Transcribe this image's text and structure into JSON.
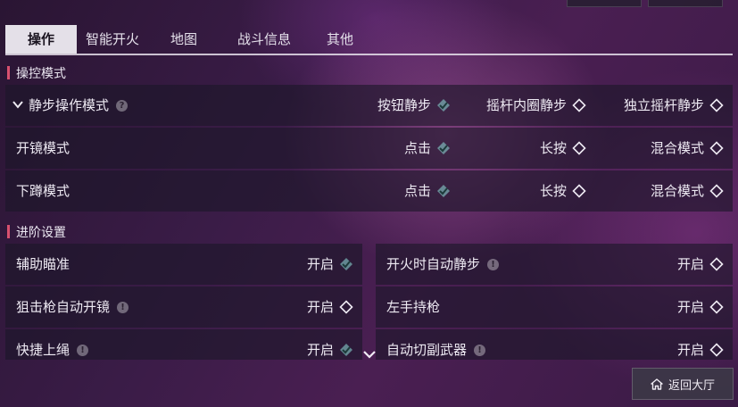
{
  "tabs": [
    {
      "label": "操作"
    },
    {
      "label": "智能开火"
    },
    {
      "label": "地图"
    },
    {
      "label": "战斗信息"
    },
    {
      "label": "其他"
    }
  ],
  "section_control": {
    "title": "操控模式",
    "rows": [
      {
        "label": "静步操作模式",
        "options": [
          "按钮静步",
          "摇杆内圈静步",
          "独立摇杆静步"
        ],
        "selected": 0
      },
      {
        "label": "开镜模式",
        "options": [
          "点击",
          "长按",
          "混合模式"
        ],
        "selected": 0
      },
      {
        "label": "下蹲模式",
        "options": [
          "点击",
          "长按",
          "混合模式"
        ],
        "selected": 0
      }
    ]
  },
  "section_advanced": {
    "title": "进阶设置",
    "items": [
      {
        "label": "辅助瞄准",
        "value": "开启",
        "checked": true,
        "info": false
      },
      {
        "label": "开火时自动静步",
        "value": "开启",
        "checked": false,
        "info": true
      },
      {
        "label": "狙击枪自动开镜",
        "value": "开启",
        "checked": false,
        "info": true
      },
      {
        "label": "左手持枪",
        "value": "开启",
        "checked": false,
        "info": false
      },
      {
        "label": "快捷上绳",
        "value": "开启",
        "checked": true,
        "info": true
      },
      {
        "label": "自动切副武器",
        "value": "开启",
        "checked": false,
        "info": true
      }
    ]
  },
  "help_glyph": "?",
  "info_glyph": "!",
  "return_button": {
    "label": "返回大厅",
    "icon": "home-icon"
  },
  "colors": {
    "accent": "#d8506e",
    "check": "#7fd8d2",
    "active_tab_bg": "#e4e0e8"
  }
}
